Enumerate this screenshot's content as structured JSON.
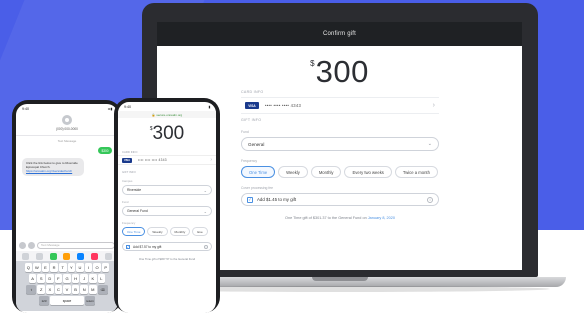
{
  "colors": {
    "brand_blue": "#4a5ee8",
    "accent": "#4a90e2",
    "imessage_green": "#35c759",
    "visa_blue": "#1a3a8c"
  },
  "laptop": {
    "header_title": "Confirm gift",
    "currency_symbol": "$",
    "amount": "300",
    "card_info_label": "CARD INFO",
    "card_brand": "VISA",
    "card_number": "•••• •••• •••• 4343",
    "gift_info_label": "GIFT INFO",
    "fund_label": "Fund",
    "fund_value": "General",
    "frequency_label": "Frequency",
    "frequencies": [
      "One Time",
      "Weekly",
      "Monthly",
      "Every two weeks",
      "Twice a month"
    ],
    "frequency_selected": "One Time",
    "cover_label": "Cover processing fee",
    "cover_text": "Add $1.45 to my gift",
    "summary_text": "One Time gift of $301.37 to the General Fund on",
    "summary_date": "January 8, 2020"
  },
  "phone_messages": {
    "time": "9:40",
    "signal": "••• ▮",
    "contact_number": "(000) 000-0000",
    "timestamp": "Text Message",
    "sent_message": "$300",
    "reply_text": "Click the link below to give to Riverside Episcopal Church.",
    "reply_link": "https://onrealm.org/riversidechurch",
    "input_placeholder": "Text Message",
    "keyboard": {
      "row1": [
        "Q",
        "W",
        "E",
        "R",
        "T",
        "Y",
        "U",
        "I",
        "O",
        "P"
      ],
      "row2": [
        "A",
        "S",
        "D",
        "F",
        "G",
        "H",
        "J",
        "K",
        "L"
      ],
      "row3": [
        "⇧",
        "Z",
        "X",
        "C",
        "V",
        "B",
        "N",
        "M",
        "⌫"
      ],
      "row4_left": "123",
      "row4_space": "space",
      "row4_right": "return"
    }
  },
  "phone_app": {
    "time": "9:40",
    "url": "🔒 secure.onrealm.org",
    "currency_symbol": "$",
    "amount": "300",
    "card_info_label": "CARD INFO",
    "card_brand": "VISA",
    "card_number": "•••• •••• •••• 4343",
    "gift_info_label": "GIFT INFO",
    "campus_label": "Campus",
    "campus_value": "Riverside",
    "fund_label": "Fund",
    "fund_value": "General Fund",
    "frequency_label": "Frequency",
    "frequencies": [
      "One Time",
      "Weekly",
      "Monthly",
      "Eve"
    ],
    "cover_text": "Add $7.57 to my gift",
    "summary_text": "One Time gift of $307.57 to the General Fund"
  }
}
